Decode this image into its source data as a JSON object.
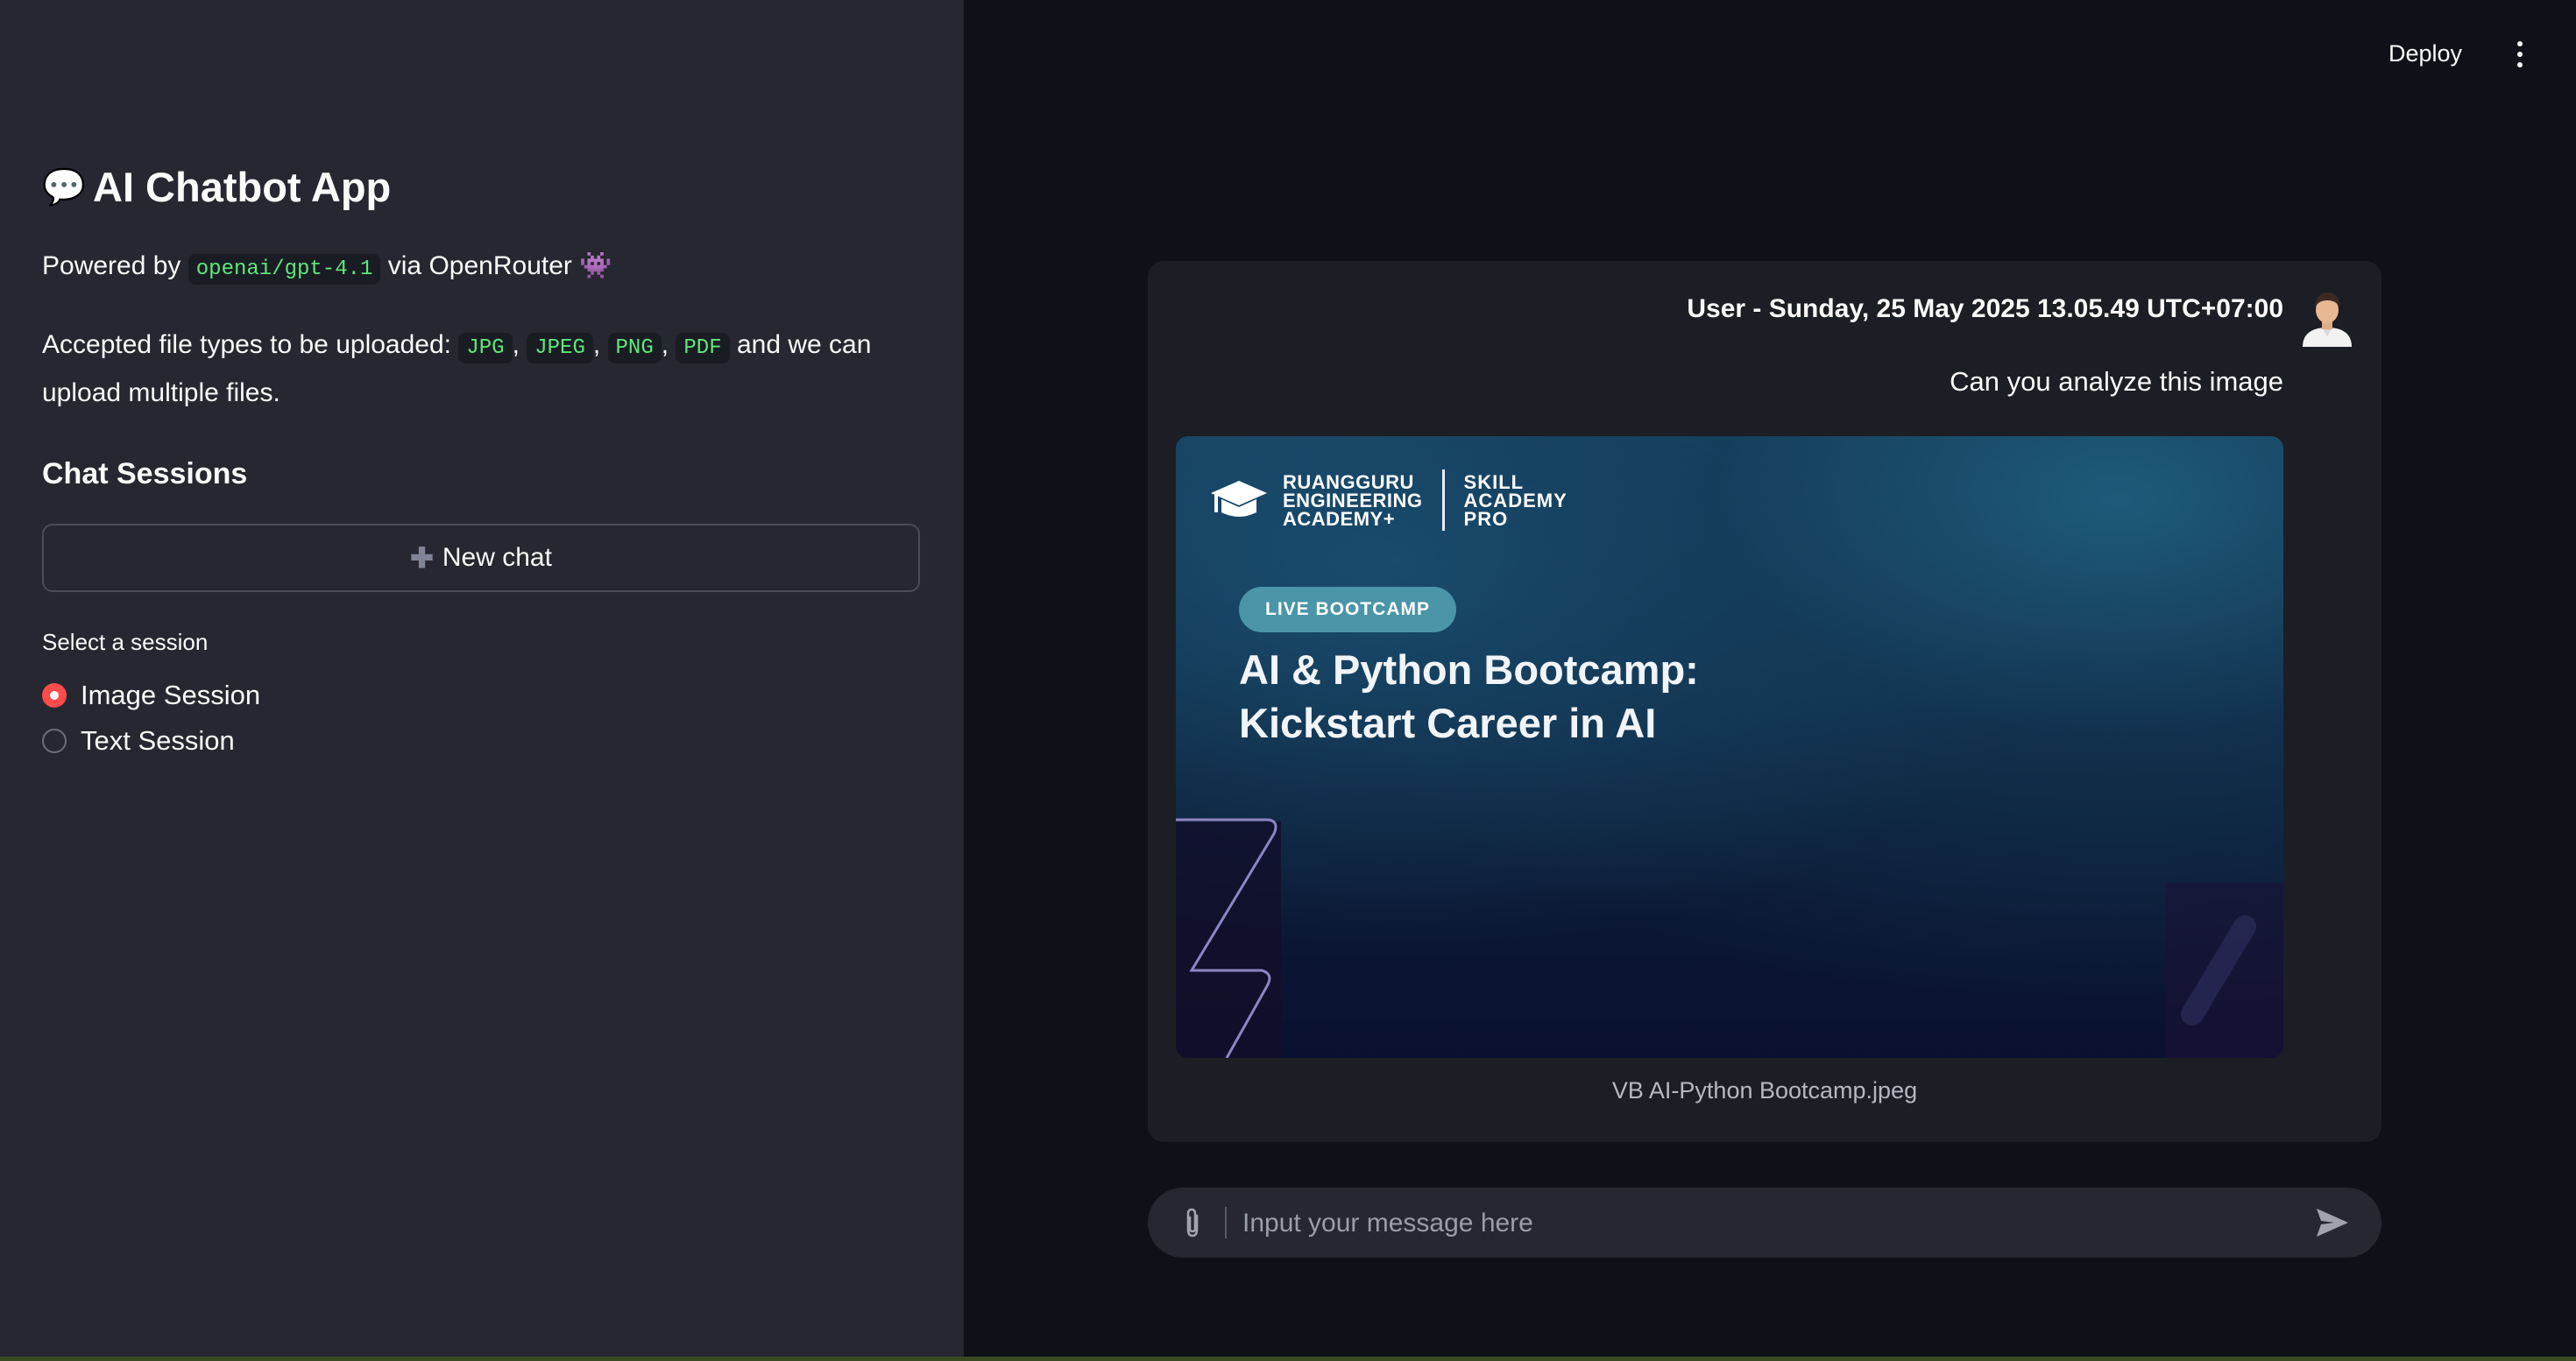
{
  "sidebar": {
    "title_emoji": "💬",
    "title": "AI Chatbot App",
    "powered_prefix": "Powered by",
    "model": "openai/gpt-4.1",
    "powered_suffix": "via OpenRouter",
    "powered_emoji": "👾",
    "accepted_prefix": "Accepted file types to be uploaded:",
    "file_types": [
      "JPG",
      "JPEG",
      "PNG",
      "PDF"
    ],
    "accepted_suffix": "and we can upload multiple files.",
    "sessions_heading": "Chat Sessions",
    "new_chat_label": "New chat",
    "select_label": "Select a session",
    "sessions": [
      {
        "label": "Image Session",
        "selected": true
      },
      {
        "label": "Text Session",
        "selected": false
      }
    ]
  },
  "header": {
    "deploy_label": "Deploy"
  },
  "chat": {
    "message_meta": "User - Sunday, 25 May 2025 13.05.49 UTC+07:00",
    "message_text": "Can you analyze this image",
    "attachment": {
      "org_line1": "RUANGGURU",
      "org_line2": "ENGINEERING",
      "org_line3": "ACADEMY+",
      "brand_line1": "SKILL",
      "brand_line2": "ACADEMY",
      "brand_line3": "PRO",
      "pill": "LIVE BOOTCAMP",
      "title_line1": "AI & Python Bootcamp:",
      "title_line2": "Kickstart Career in AI",
      "caption": "VB AI-Python Bootcamp.jpeg"
    }
  },
  "input": {
    "placeholder": "Input your message here"
  },
  "colors": {
    "accent": "#ff4b4b",
    "code_text": "#5ee87a",
    "sidebar_bg": "#262730",
    "main_bg": "#0e1117",
    "pill_bg": "#4a95a8"
  },
  "icons": [
    "speech-bubble-icon",
    "alien-monster-icon",
    "plus-icon",
    "kebab-menu-icon",
    "user-avatar-icon",
    "graduation-cap-icon",
    "paperclip-icon",
    "send-icon"
  ]
}
